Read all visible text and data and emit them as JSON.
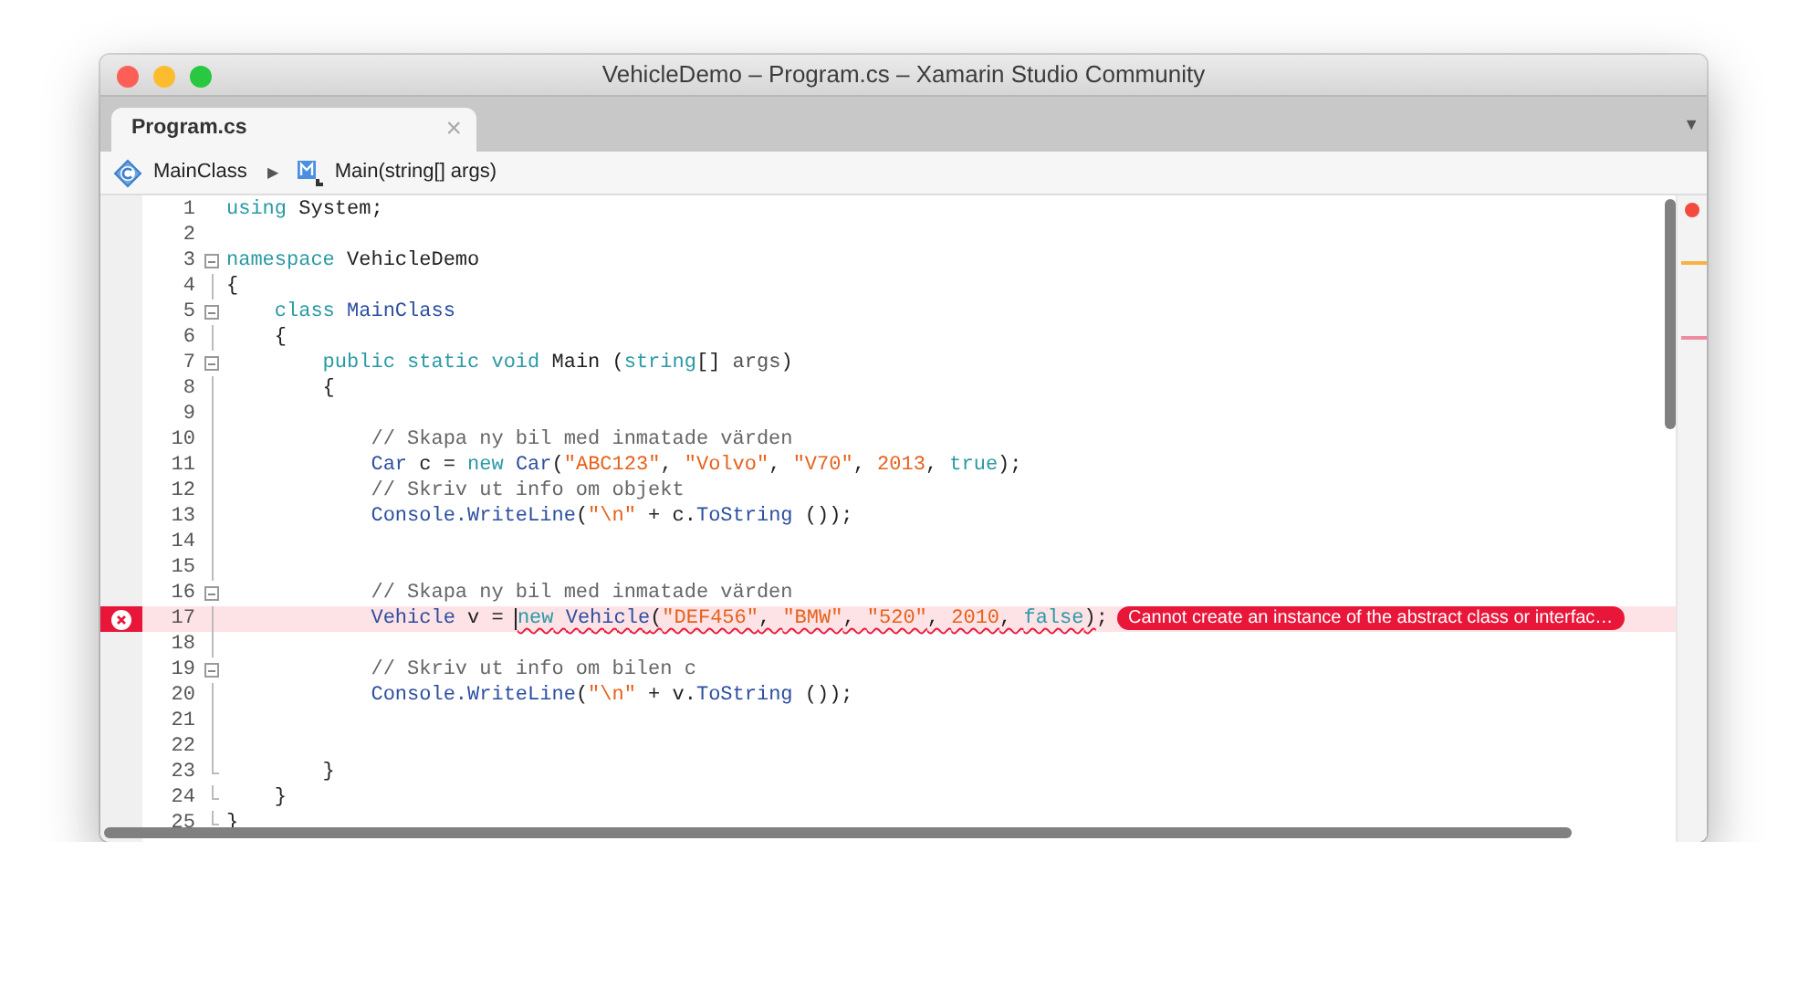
{
  "window": {
    "title": "VehicleDemo – Program.cs – Xamarin Studio Community"
  },
  "tabs": [
    {
      "label": "Program.cs",
      "selected": true,
      "close": "×"
    }
  ],
  "tab_menu": "▼",
  "breadcrumb": [
    {
      "kind": "class",
      "label": "MainClass"
    },
    {
      "kind": "separator",
      "label": "▶"
    },
    {
      "kind": "method",
      "label": "Main(string[] args)"
    }
  ],
  "lines": [
    {
      "number": "1",
      "kind": "plain",
      "tokens": [
        {
          "kind": "keyword",
          "text": "using"
        },
        {
          "kind": "plain",
          "text": " System;"
        }
      ]
    },
    {
      "number": "2",
      "kind": "plain"
    },
    {
      "number": "3",
      "kind": "toggle",
      "tokens": [
        {
          "kind": "keyword",
          "text": "namespace"
        },
        {
          "kind": "plain",
          "text": " VehicleDemo"
        }
      ]
    },
    {
      "number": "4",
      "kind": "guide",
      "tokens": [
        {
          "kind": "plain",
          "text": "{"
        }
      ]
    },
    {
      "number": "5",
      "kind": "toggle",
      "tokens": [
        {
          "kind": "keyword",
          "text": "    class"
        },
        {
          "kind": "type",
          "text": " MainClass"
        }
      ]
    },
    {
      "number": "6",
      "kind": "guide",
      "tokens": [
        {
          "kind": "plain",
          "text": "    {"
        }
      ]
    },
    {
      "number": "7",
      "kind": "toggle",
      "tokens": [
        {
          "kind": "keyword",
          "text": "        public static void"
        },
        {
          "kind": "plain",
          "text": " Main ("
        },
        {
          "kind": "keyword",
          "text": "string"
        },
        {
          "kind": "plain",
          "text": "[] "
        },
        {
          "kind": "param",
          "text": "args"
        },
        {
          "kind": "plain",
          "text": ")"
        }
      ]
    },
    {
      "number": "8",
      "kind": "guide",
      "tokens": [
        {
          "kind": "plain",
          "text": "        {"
        }
      ]
    },
    {
      "number": "9",
      "kind": "guide"
    },
    {
      "number": "10",
      "kind": "guide",
      "tokens": [
        {
          "kind": "comment",
          "text": "            // Skapa ny bil med inmatade värden"
        }
      ]
    },
    {
      "number": "11",
      "kind": "guide",
      "tokens": [
        {
          "kind": "type",
          "text": "            Car"
        },
        {
          "kind": "plain",
          "text": " c = "
        },
        {
          "kind": "keyword",
          "text": "new"
        },
        {
          "kind": "type",
          "text": " Car"
        },
        {
          "kind": "plain",
          "text": "("
        },
        {
          "kind": "string",
          "text": "\"ABC123\""
        },
        {
          "kind": "plain",
          "text": ", "
        },
        {
          "kind": "string",
          "text": "\"Volvo\""
        },
        {
          "kind": "plain",
          "text": ", "
        },
        {
          "kind": "string",
          "text": "\"V70\""
        },
        {
          "kind": "plain",
          "text": ", "
        },
        {
          "kind": "number",
          "text": "2013"
        },
        {
          "kind": "plain",
          "text": ", "
        },
        {
          "kind": "keyword",
          "text": "true"
        },
        {
          "kind": "plain",
          "text": ");"
        }
      ]
    },
    {
      "number": "12",
      "kind": "guide",
      "tokens": [
        {
          "kind": "comment",
          "text": "            // Skriv ut info om objekt"
        }
      ]
    },
    {
      "number": "13",
      "kind": "guide",
      "tokens": [
        {
          "kind": "type",
          "text": "            Console.WriteLine"
        },
        {
          "kind": "plain",
          "text": "("
        },
        {
          "kind": "string",
          "text": "\"\\n\""
        },
        {
          "kind": "plain",
          "text": " + c."
        },
        {
          "kind": "type",
          "text": "ToString"
        },
        {
          "kind": "plain",
          "text": " ());"
        }
      ]
    },
    {
      "number": "14",
      "kind": "guide"
    },
    {
      "number": "15",
      "kind": "guide"
    },
    {
      "number": "16",
      "kind": "toggle",
      "tokens": [
        {
          "kind": "comment",
          "text": "            // Skapa ny bil med inmatade värden"
        }
      ]
    },
    {
      "number": "17",
      "kind": "guide",
      "cursor": true,
      "tokens": [
        {
          "kind": "type",
          "text": "            Vehicle"
        },
        {
          "kind": "plain",
          "text": " v = "
        }
      ],
      "flagged_tokens": [
        {
          "kind": "keyword",
          "text": "new"
        },
        {
          "kind": "type",
          "text": " Vehicle"
        },
        {
          "kind": "plain",
          "text": "("
        },
        {
          "kind": "string",
          "text": "\"DEF456\""
        },
        {
          "kind": "plain",
          "text": ", "
        },
        {
          "kind": "string",
          "text": "\"BMW\""
        },
        {
          "kind": "plain",
          "text": ", "
        },
        {
          "kind": "string",
          "text": "\"520\""
        },
        {
          "kind": "plain",
          "text": ", "
        },
        {
          "kind": "number",
          "text": "2010"
        },
        {
          "kind": "plain",
          "text": ", "
        },
        {
          "kind": "keyword",
          "text": "false"
        },
        {
          "kind": "plain",
          "text": ")"
        }
      ],
      "after_tokens": [
        {
          "kind": "plain",
          "text": ";"
        }
      ],
      "error": "Cannot create an instance of the abstract class or interfac…"
    },
    {
      "number": "18",
      "kind": "guide"
    },
    {
      "number": "19",
      "kind": "toggle",
      "tokens": [
        {
          "kind": "comment",
          "text": "            // Skriv ut info om bilen c"
        }
      ]
    },
    {
      "number": "20",
      "kind": "guide",
      "tokens": [
        {
          "kind": "type",
          "text": "            Console.WriteLine"
        },
        {
          "kind": "plain",
          "text": "("
        },
        {
          "kind": "string",
          "text": "\"\\n\""
        },
        {
          "kind": "plain",
          "text": " + v."
        },
        {
          "kind": "type",
          "text": "ToString"
        },
        {
          "kind": "plain",
          "text": " ());"
        }
      ]
    },
    {
      "number": "21",
      "kind": "guide"
    },
    {
      "number": "22",
      "kind": "guide"
    },
    {
      "number": "23",
      "kind": "end",
      "tokens": [
        {
          "kind": "plain",
          "text": "        }"
        }
      ]
    },
    {
      "number": "24",
      "kind": "end",
      "tokens": [
        {
          "kind": "plain",
          "text": "    }"
        }
      ]
    },
    {
      "number": "25",
      "kind": "end",
      "tokens": [
        {
          "kind": "plain",
          "text": "}"
        }
      ]
    }
  ]
}
